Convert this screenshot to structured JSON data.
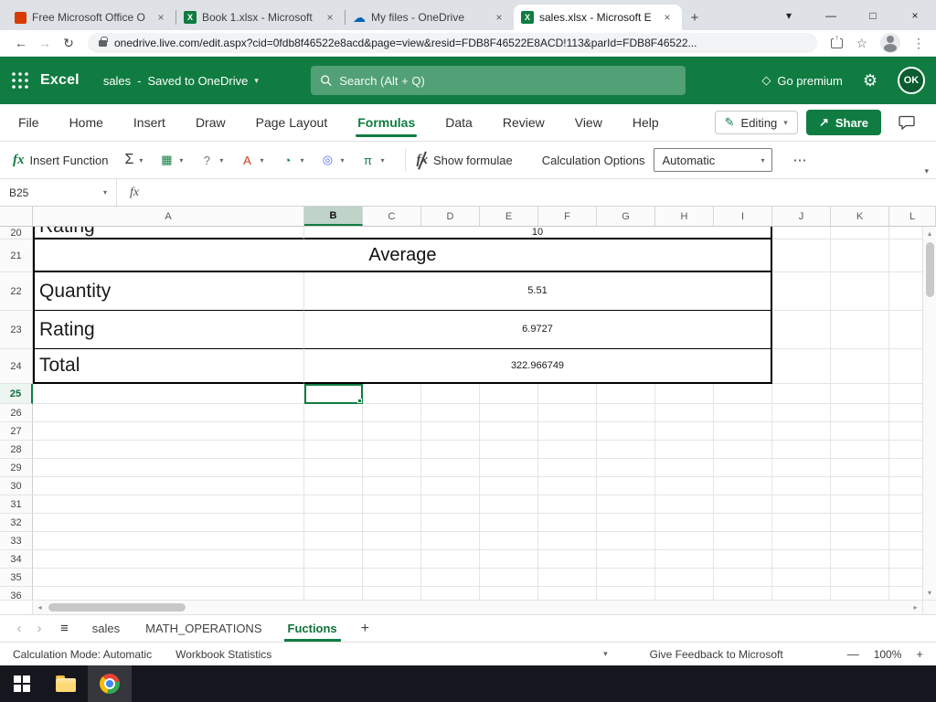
{
  "browser": {
    "tabs": [
      {
        "title": "Free Microsoft Office O",
        "icon": "office"
      },
      {
        "title": "Book 1.xlsx - Microsoft",
        "icon": "excel"
      },
      {
        "title": "My files - OneDrive",
        "icon": "onedrive"
      },
      {
        "title": "sales.xlsx - Microsoft E",
        "icon": "excel"
      }
    ],
    "active_tab_index": 3,
    "url": "onedrive.live.com/edit.aspx?cid=0fdb8f46522e8acd&page=view&resid=FDB8F46522E8ACD!113&parId=FDB8F46522..."
  },
  "app_header": {
    "app_name": "Excel",
    "doc_name": "sales",
    "doc_separator": "-",
    "save_status": "Saved to OneDrive",
    "search_placeholder": "Search (Alt + Q)",
    "go_premium_label": "Go premium",
    "avatar_initials": "OK"
  },
  "menu_bar": {
    "items": [
      "File",
      "Home",
      "Insert",
      "Draw",
      "Page Layout",
      "Formulas",
      "Data",
      "Review",
      "View",
      "Help"
    ],
    "active_item": "Formulas",
    "editing_label": "Editing",
    "share_label": "Share"
  },
  "ribbon": {
    "insert_function_label": "Insert Function",
    "show_formulae_label": "Show formulae",
    "calculation_options_label": "Calculation Options",
    "calculation_mode": "Automatic",
    "function_group_icons": [
      "▦",
      "?",
      "A",
      "◔",
      "◎",
      "π"
    ]
  },
  "formula_bar": {
    "name_box": "B25",
    "formula_value": ""
  },
  "grid": {
    "columns": [
      "A",
      "B",
      "C",
      "D",
      "E",
      "F",
      "G",
      "H",
      "I",
      "J",
      "K",
      "L"
    ],
    "selected_column": "B",
    "selected_cell": "B25",
    "row_numbers": [
      20,
      21,
      22,
      23,
      24,
      25,
      26,
      27,
      28,
      29,
      30,
      31,
      32,
      33,
      34,
      35,
      36
    ],
    "table": {
      "partial_row": {
        "label": "Rating",
        "value": "10"
      },
      "header": "Average",
      "rows": [
        {
          "label": "Quantity",
          "value": "5.51"
        },
        {
          "label": "Rating",
          "value": "6.9727"
        },
        {
          "label": "Total",
          "value": "322.966749"
        }
      ]
    }
  },
  "sheet_bar": {
    "tabs": [
      "sales",
      "MATH_OPERATIONS",
      "Fuctions"
    ],
    "active_tab": "Fuctions"
  },
  "status_bar": {
    "calculation_mode": "Calculation Mode: Automatic",
    "workbook_statistics": "Workbook Statistics",
    "feedback": "Give Feedback to Microsoft",
    "zoom_level": "100%"
  },
  "icons": {
    "chevron_down": "▾",
    "minimize": "—",
    "maximize": "□",
    "close": "×",
    "back_arrow": "←",
    "forward_arrow": "→",
    "refresh": "↻",
    "star": "☆",
    "kebab": "⋮",
    "plus": "+",
    "cloud": "☁",
    "excel_letter": "X",
    "diamond": "◇",
    "gear": "⚙",
    "pencil": "✎",
    "share_arrow": "↗",
    "sigma": "Σ",
    "fx": "fx",
    "ellipsis": "⋯",
    "hamburger": "≡",
    "nav_left": "‹",
    "nav_right": "›",
    "scroll_up": "▴",
    "scroll_down": "▾",
    "scroll_left": "◂",
    "scroll_right": "▸",
    "zoom_out": "—",
    "zoom_in": "+"
  },
  "colors": {
    "excel_green": "#107C41",
    "tab_strip": "#DEE1E6",
    "taskbar": "#16161E",
    "grid_line": "#E4E4E4",
    "table_border": "#000000"
  }
}
